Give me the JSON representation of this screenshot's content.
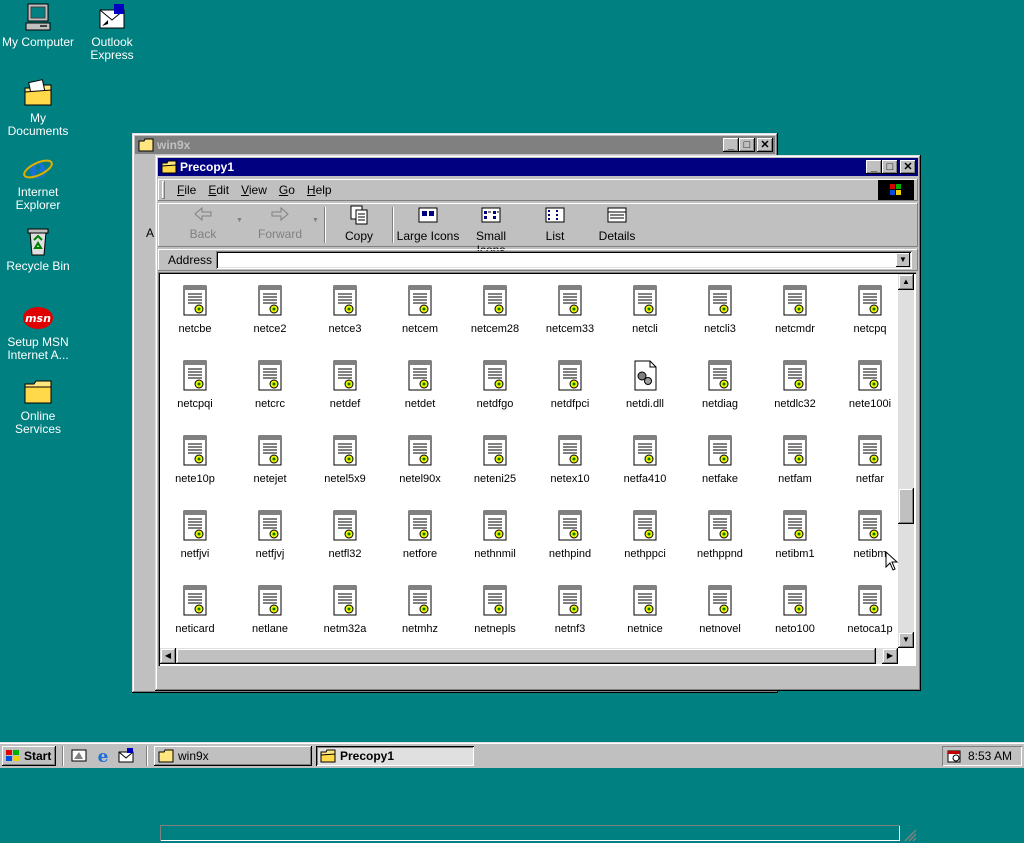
{
  "desktop": {
    "icons": [
      {
        "label": "My Computer"
      },
      {
        "label": "Outlook Express"
      },
      {
        "label": "My Documents"
      },
      {
        "label": "Internet Explorer"
      },
      {
        "label": "Recycle Bin"
      },
      {
        "label": "Setup MSN Internet A..."
      },
      {
        "label": "Online Services"
      }
    ]
  },
  "back_window": {
    "title": "win9x",
    "side_letter": "A"
  },
  "window": {
    "title": "Precopy1",
    "menu": [
      {
        "label": "File",
        "key": "F",
        "rest": "ile"
      },
      {
        "label": "Edit",
        "key": "E",
        "rest": "dit"
      },
      {
        "label": "View",
        "key": "V",
        "rest": "iew"
      },
      {
        "label": "Go",
        "key": "G",
        "rest": "o"
      },
      {
        "label": "Help",
        "key": "H",
        "rest": "elp"
      }
    ],
    "toolbar": {
      "back": "Back",
      "forward": "Forward",
      "copy": "Copy",
      "large_icons": "Large Icons",
      "small_icons": "Small Icons",
      "list": "List",
      "details": "Details"
    },
    "address": {
      "label": "Address",
      "value": ""
    },
    "files": [
      "netcbe",
      "netce2",
      "netce3",
      "netcem",
      "netcem28",
      "netcem33",
      "netcli",
      "netcli3",
      "netcmdr",
      "netcpq",
      "netcpqi",
      "netcrc",
      "netdef",
      "netdet",
      "netdfgo",
      "netdfpci",
      "netdi.dll",
      "netdiag",
      "netdlc32",
      "nete100i",
      "nete10p",
      "netejet",
      "netel5x9",
      "netel90x",
      "neteni25",
      "netex10",
      "netfa410",
      "netfake",
      "netfam",
      "netfar",
      "netfjvi",
      "netfjvj",
      "netfl32",
      "netfore",
      "nethnmil",
      "nethpind",
      "nethppci",
      "nethppnd",
      "netibm1",
      "netibm",
      "neticard",
      "netlane",
      "netm32a",
      "netmhz",
      "netnepls",
      "netnf3",
      "netnice",
      "netnovel",
      "neto100",
      "netoca1p"
    ],
    "dll_file": "netdi.dll"
  },
  "taskbar": {
    "start": "Start",
    "tasks": [
      {
        "label": "win9x",
        "active": false
      },
      {
        "label": "Precopy1",
        "active": true
      }
    ],
    "clock": "8:53 AM"
  },
  "colors": {
    "desktop": "#008080",
    "title_active": "#000080",
    "title_inactive": "#808080"
  }
}
